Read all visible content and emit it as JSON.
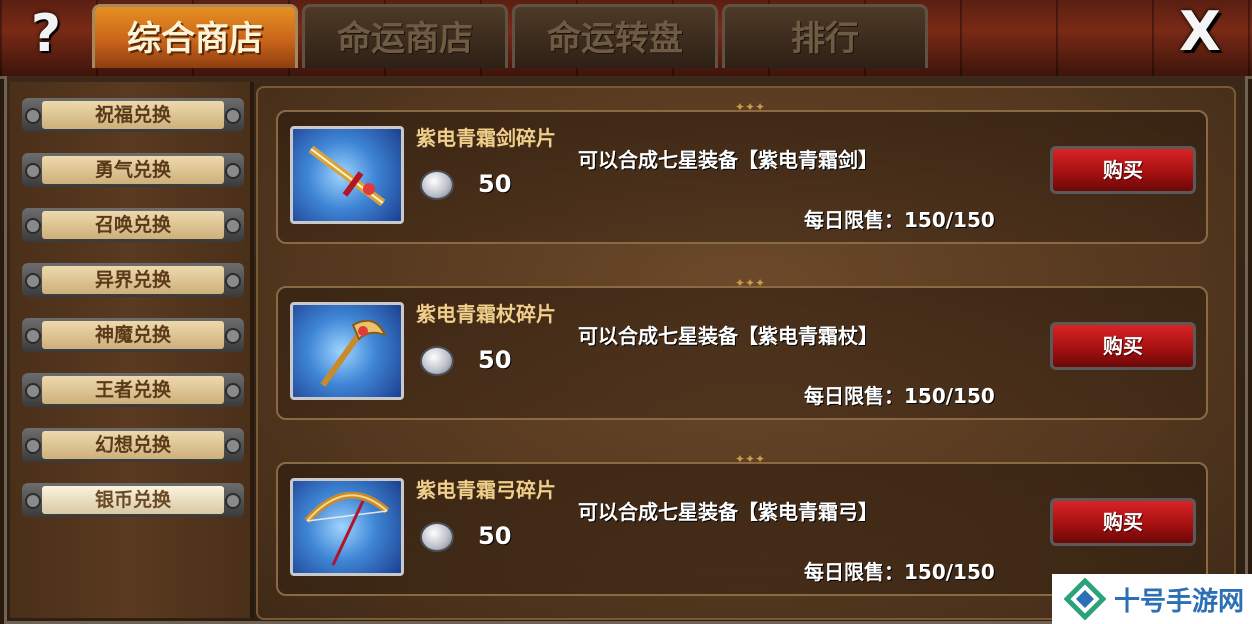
{
  "header": {
    "help_icon": "?",
    "close_icon": "X",
    "tabs": [
      {
        "label": "综合商店",
        "active": true
      },
      {
        "label": "命运商店",
        "active": false
      },
      {
        "label": "命运转盘",
        "active": false
      },
      {
        "label": "排行",
        "active": false
      }
    ]
  },
  "sidebar": {
    "items": [
      {
        "label": "祝福兑换"
      },
      {
        "label": "勇气兑换"
      },
      {
        "label": "召唤兑换"
      },
      {
        "label": "异界兑换"
      },
      {
        "label": "神魔兑换"
      },
      {
        "label": "王者兑换"
      },
      {
        "label": "幻想兑换"
      },
      {
        "label": "银币兑换"
      }
    ],
    "active_index": 7
  },
  "items": [
    {
      "name": "紫电青霜剑碎片",
      "icon": "sword-icon",
      "price": "50",
      "currency_icon": "silver-coin-icon",
      "description": "可以合成七星装备【紫电青霜剑】",
      "limit": "每日限售：150/150",
      "buy_label": "购买"
    },
    {
      "name": "紫电青霜杖碎片",
      "icon": "staff-icon",
      "price": "50",
      "currency_icon": "silver-coin-icon",
      "description": "可以合成七星装备【紫电青霜杖】",
      "limit": "每日限售：150/150",
      "buy_label": "购买"
    },
    {
      "name": "紫电青霜弓碎片",
      "icon": "bow-icon",
      "price": "50",
      "currency_icon": "silver-coin-icon",
      "description": "可以合成七星装备【紫电青霜弓】",
      "limit": "每日限售：150/150",
      "buy_label": "购买"
    }
  ],
  "watermark": {
    "text": "十号手游网",
    "color": "#2b6fb4"
  },
  "colors": {
    "active_tab": "#e78f22",
    "buy_button": "#c21818",
    "item_name": "#f0cf8a"
  }
}
